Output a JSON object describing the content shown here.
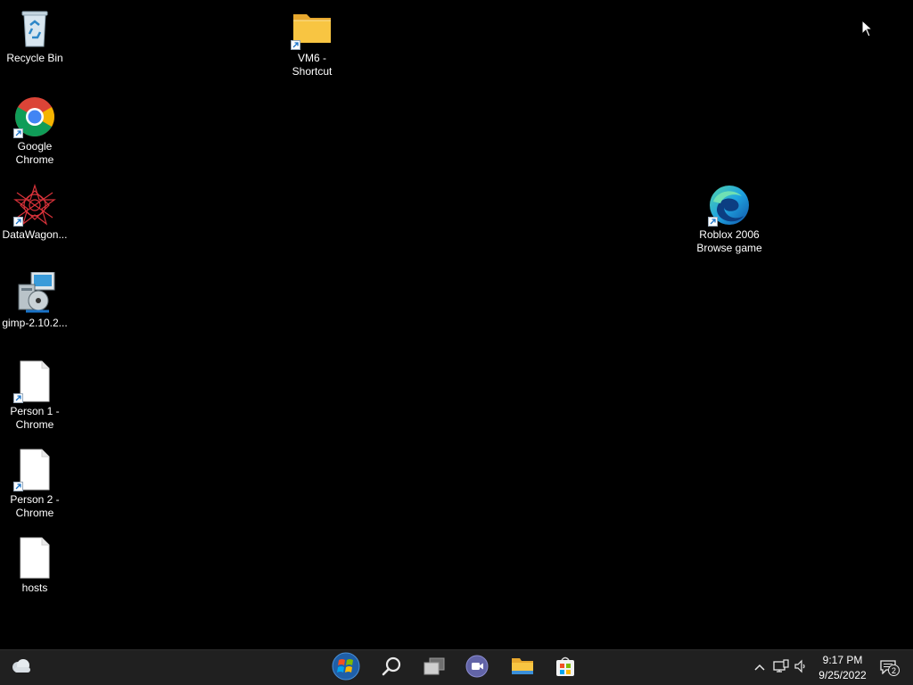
{
  "desktop": {
    "icons": [
      {
        "label": "Recycle Bin"
      },
      {
        "label": "Google\nChrome"
      },
      {
        "label": "DataWagon..."
      },
      {
        "label": "gimp-2.10.2..."
      },
      {
        "label": "Person 1 -\nChrome"
      },
      {
        "label": "Person 2 -\nChrome"
      },
      {
        "label": "hosts"
      },
      {
        "label": "VM6 -\nShortcut"
      },
      {
        "label": "Roblox 2006\nBrowse game"
      }
    ]
  },
  "taskbar": {
    "clock": {
      "time": "9:17 PM",
      "date": "9/25/2022"
    },
    "notification_count": "2"
  },
  "colors": {
    "desktop_bg": "#000000",
    "taskbar_bg": "#202020",
    "folder_yellow": "#f8c542"
  }
}
